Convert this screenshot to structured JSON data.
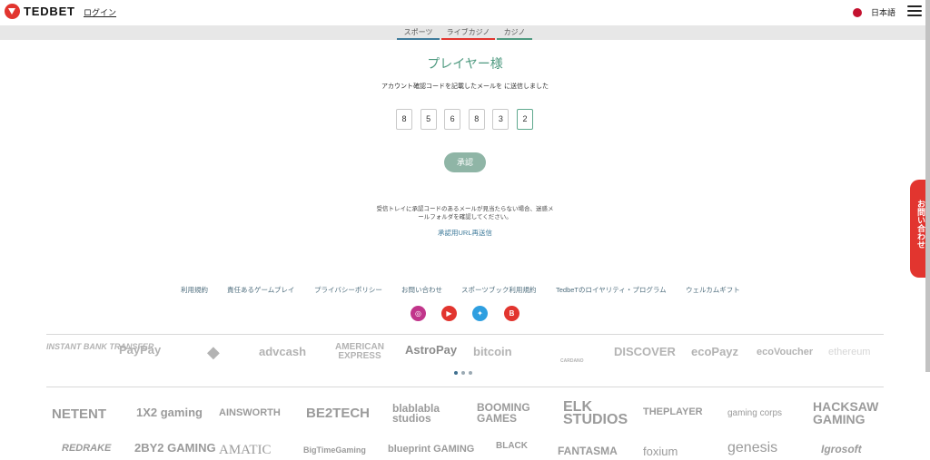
{
  "header": {
    "brand": "TEDBET",
    "login_label": "ログイン",
    "language": "日本語"
  },
  "nav": {
    "tabs": [
      {
        "label": "スポーツ",
        "color": "#3f7b9b"
      },
      {
        "label": "ライブカジノ",
        "color": "#e2352f"
      },
      {
        "label": "カジノ",
        "color": "#4f9a80"
      }
    ]
  },
  "main": {
    "title": "プレイヤー様",
    "sent_text": "アカウント確認コードを記載したメールを に送信しました",
    "code_digits": [
      "8",
      "5",
      "6",
      "8",
      "3",
      "2"
    ],
    "approve_label": "承認",
    "inbox_note": "受信トレイに承認コードのあるメールが見当たらない場合、迷惑メールフォルダを確認してください。",
    "resend_label": "承認用URL再送信"
  },
  "contact_tab": "お問い合わせ",
  "footer": {
    "links": [
      "利用規約",
      "責任あるゲームプレイ",
      "プライバシーポリシー",
      "お問い合わせ",
      "スポーツブック利用規約",
      "TedbeTのロイヤリティ・プログラム",
      "ウェルカムギフト"
    ],
    "social": [
      {
        "name": "instagram-icon",
        "color": "#c1358b"
      },
      {
        "name": "youtube-icon",
        "color": "#e2352f"
      },
      {
        "name": "twitter-icon",
        "color": "#2f9fe0"
      },
      {
        "name": "blog-icon",
        "color": "#e2352f"
      }
    ],
    "payments": [
      "INSTANT BANK TRANSFER",
      "PayPay",
      "◆",
      "advcash",
      "AMERICAN EXPRESS",
      "AstroPay",
      "bitcoin",
      "CARDANO",
      "DISCOVER",
      "ecoPayz",
      "ecoVoucher",
      "ethereum"
    ],
    "providers_row1": [
      "NETENT",
      "1X2 gaming",
      "AINSWORTH",
      "BE2TECH",
      "blablabla studios",
      "BOOMING GAMES",
      "ELK STUDIOS",
      "THEPLAYER",
      "gaming corps",
      "HACKSAW GAMING"
    ],
    "providers_row2": [
      "REDRAKE",
      "2BY2 GAMING",
      "AMATIC",
      "BigTimeGaming",
      "blueprint GAMING",
      "BLACK",
      "FANTASMA",
      "foxium",
      "genesis",
      "Igrosoft"
    ]
  },
  "colors": {
    "accent": "#4f9a80",
    "brand_red": "#e2352f",
    "link_blue": "#3f7b9b",
    "button": "#8fb5a6"
  }
}
